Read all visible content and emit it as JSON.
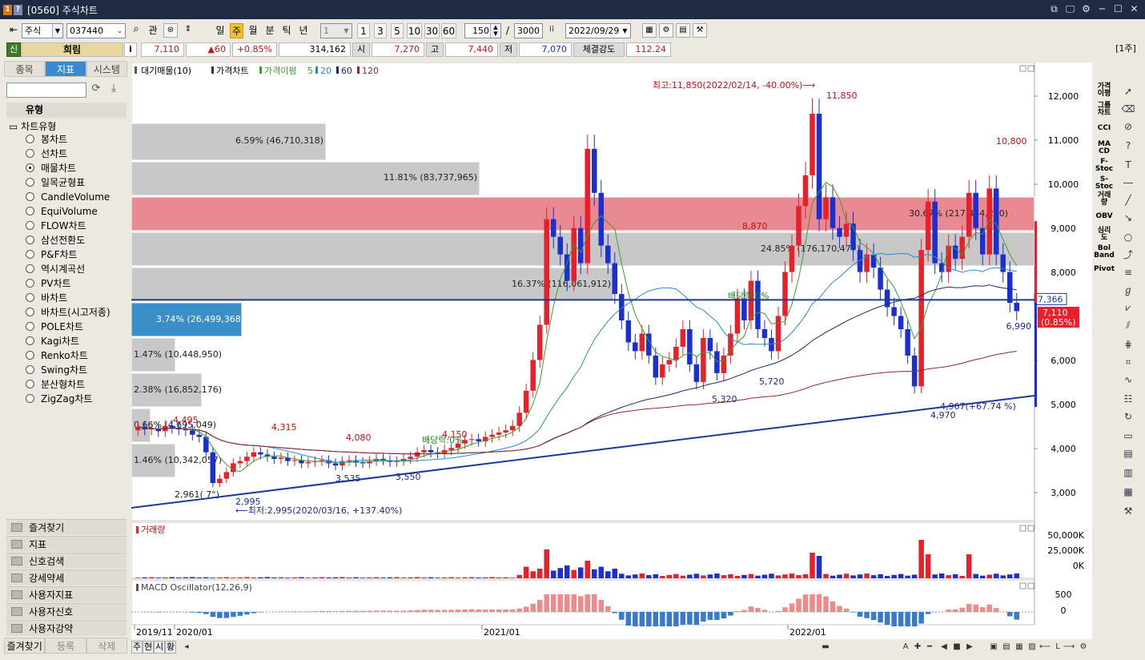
{
  "window": {
    "icon1": "1",
    "icon2": "?",
    "title": "[0560] 주식차트",
    "btns": [
      "⧉",
      "🖵",
      "⚙",
      "─",
      "☐",
      "✕"
    ]
  },
  "toolbar": {
    "market": "주식",
    "code": "037440",
    "search_icon": "⌕",
    "gwan": "관",
    "periods": [
      "일",
      "주",
      "월",
      "분",
      "틱",
      "년"
    ],
    "active_period": "주",
    "interval": "1",
    "quick": [
      "1",
      "3",
      "5",
      "10",
      "30",
      "60"
    ],
    "count": "150",
    "slash": "/",
    "total": "3000",
    "date": "2022/09/29"
  },
  "quote": {
    "badge": "신",
    "name": "희림",
    "info_icon": "i",
    "price": "7,110",
    "change": "▲60",
    "rate": "+0.85%",
    "volume": "314,162",
    "open_label": "시",
    "open": "7,270",
    "high_label": "고",
    "high": "7,440",
    "low_label": "저",
    "low": "7,070",
    "strength_label": "체결강도",
    "strength": "112.24",
    "unit": "[1주]"
  },
  "left": {
    "tabs": [
      "종목",
      "지표",
      "시스템"
    ],
    "active_tab": "지표",
    "section": "유형",
    "subsection": "차트유형",
    "types": [
      "봉차트",
      "선차트",
      "매물차트",
      "일목균형표",
      "CandleVolume",
      "EquiVolume",
      "FLOW차트",
      "삼선전환도",
      "P&F차트",
      "역시계곡선",
      "PV차트",
      "바차트",
      "바차트(시고저종)",
      "POLE차트",
      "Kagi차트",
      "Renko차트",
      "Swing차트",
      "분산형차트",
      "ZigZag차트"
    ],
    "selected": "매물차트",
    "groups": [
      "즐겨찾기",
      "지표",
      "신호검색",
      "강세약세",
      "사용자지표",
      "사용자신호",
      "사용자강약"
    ],
    "footer": [
      "즐겨찾기",
      "등록",
      "삭제"
    ]
  },
  "chart": {
    "legend": {
      "vp": "대기매물(10)",
      "price": "가격차트",
      "disparity": "가격이평",
      "ma": [
        "5",
        "20",
        "60",
        "120"
      ]
    },
    "volume_title": "거래량",
    "macd_title": "MACD Oscillator(12,26,9)",
    "y_ticks": [
      "12,000",
      "11,000",
      "10,000",
      "9,000",
      "8,000",
      "7,000",
      "6,000",
      "5,000",
      "4,000",
      "3,000"
    ],
    "vol_ticks": [
      "50,000K",
      "25,000K",
      "0K"
    ],
    "macd_ticks": [
      "500",
      "0"
    ],
    "x_ticks": [
      "2019/11",
      "2020/01",
      "2021/01",
      "2022/01"
    ],
    "vp_labels": [
      "6.59% (46,710,318)",
      "11.81% (83,737,965)",
      "30.67% (217,444,210)",
      "24.85% (176,170,477)",
      "16.37% (116,061,912)",
      "3.74% (26,499,368)",
      "1.47% (10,448,950)",
      "2.38% (16,852,176)",
      "0.66% (4,695,049)",
      "1.46% (10,342,057)"
    ],
    "annot_high": "최고:11,850(2022/02/14, -40.00%)⟶",
    "annot_low": "⟵최저:2,995(2020/03/16, +137.40%)",
    "trend_label": "4,967(+67.74 %)",
    "peak_labels": [
      "11,850",
      "10,800",
      "8,870",
      "5,320",
      "5,720",
      "4,970",
      "6,990",
      "2,995",
      "3,535",
      "3,550",
      "4,315",
      "4,080",
      "4,150",
      "2,961(  7°)",
      "4,495"
    ],
    "dividend": "배당락:0%",
    "current_line": "7,366",
    "current_price": "7,110",
    "current_rate": "(0.85%)",
    "colors": {
      "up": "#e8202a",
      "down": "#1a2fd0",
      "ma5": "#3aa02a",
      "ma20": "#2a8ad0",
      "ma60": "#1a2a6e",
      "ma120": "#8a2a3a",
      "vp_gray": "#c8c8c8",
      "vp_red": "#e98a92",
      "vp_blue": "#3a8fc8"
    }
  },
  "bottom": {
    "tabs": [
      "주",
      "현",
      "시",
      "황"
    ]
  }
}
